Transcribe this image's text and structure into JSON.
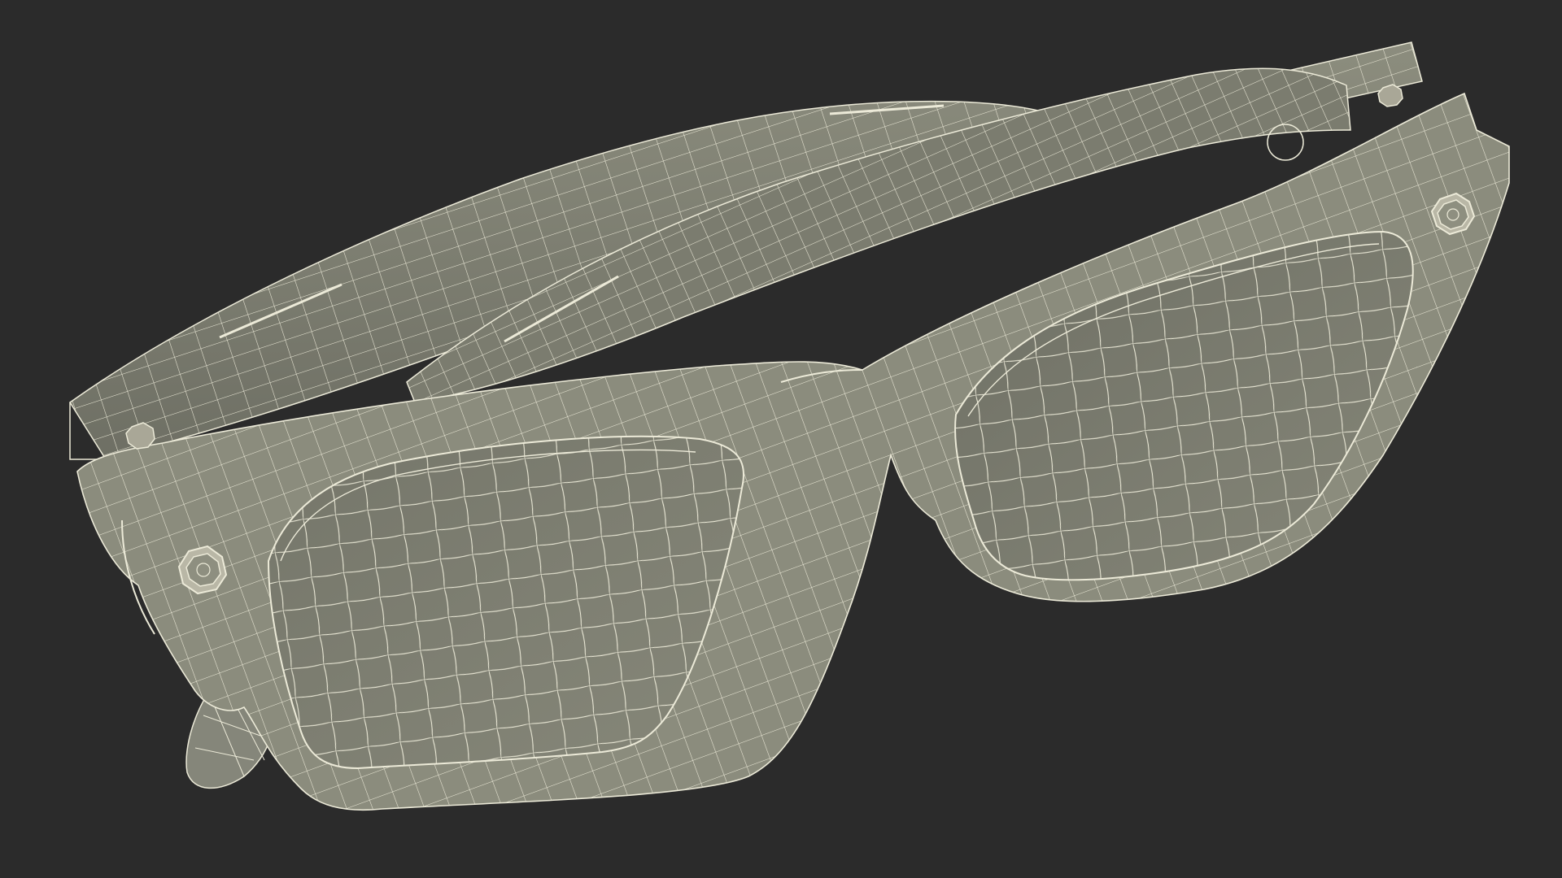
{
  "scene": {
    "subject": "sunglasses-wireframe-model",
    "colors": {
      "background": "#2b2b2b",
      "frame_fill": "#8a8b7b",
      "frame_fill_shadow": "#6f7064",
      "lens_fill": "#7f8072",
      "lens_fill_dark": "#6c6d62",
      "temple_fill": "#7e7f71",
      "wire": "#ecead8",
      "wire_dim": "#d9d7c6",
      "rivet": "#c9c7b6"
    }
  }
}
